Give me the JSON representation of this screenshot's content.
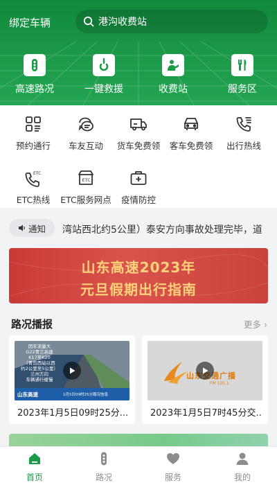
{
  "header": {
    "bind_car": "绑定车辆",
    "search_text": "港沟收费站",
    "quick": [
      {
        "label": "高速路况",
        "icon": "traffic-light-icon"
      },
      {
        "label": "一键救援",
        "icon": "rescue-hook-icon"
      },
      {
        "label": "收费站",
        "icon": "toll-station-icon"
      },
      {
        "label": "服务区",
        "icon": "service-area-icon"
      }
    ]
  },
  "services": [
    {
      "label": "预约通行",
      "icon": "grid-apps-icon"
    },
    {
      "label": "车友互动",
      "icon": "chat-bubble-icon"
    },
    {
      "label": "货车免费领",
      "icon": "truck-icon"
    },
    {
      "label": "客车免费领",
      "icon": "car-icon"
    },
    {
      "label": "出行热线",
      "icon": "phone-icon"
    },
    {
      "label": "ETC热线",
      "icon": "etc-phone-icon"
    },
    {
      "label": "ETC服务网点",
      "icon": "etc-outlet-icon"
    },
    {
      "label": "疫情防控",
      "icon": "first-aid-icon"
    }
  ],
  "notice": {
    "tag": "通知",
    "text": "湾站西北约5公里）泰安方向事故处理完毕，道"
  },
  "banner": {
    "line1": "山东高速2023年",
    "line2": "元旦假期出行指南"
  },
  "road": {
    "title": "路况播报",
    "more": "更多",
    "cards": [
      {
        "title": "2023年1月5日09时25分...",
        "thumb_lines": [
          "因车流量大",
          "G22青兰高速",
          "K17至K20",
          "（青岛西站以西",
          "约2公里至5公里）",
          "兰州方向",
          "车辆通行缓慢"
        ],
        "thumb_brand": "山东高速",
        "thumb_caption": "1月5日09时25分路况信息"
      },
      {
        "title": "2023年1月5日7时45分交...",
        "thumb_brand": "山东交通广播",
        "thumb_caption": "FM 101.1"
      }
    ]
  },
  "tabs": [
    {
      "label": "首页",
      "icon": "home-icon",
      "active": true
    },
    {
      "label": "路况",
      "icon": "traffic-light-icon",
      "active": false
    },
    {
      "label": "服务",
      "icon": "heart-icon",
      "active": false
    },
    {
      "label": "我的",
      "icon": "user-icon",
      "active": false
    }
  ],
  "colors": {
    "brand_green": "#1c9a48",
    "active_tab": "#1c9a48",
    "inactive_tab": "#8c8c8c",
    "banner_red": "#d9534c",
    "banner_text": "#ffd27a"
  }
}
